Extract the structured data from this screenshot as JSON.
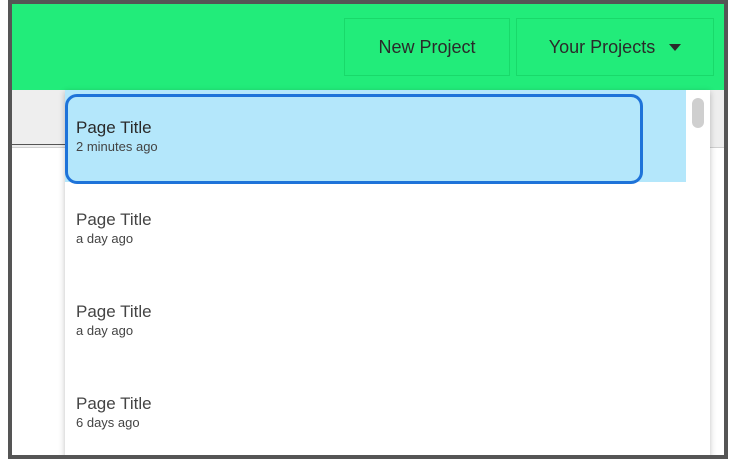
{
  "topbar": {
    "new_project_label": "New Project",
    "your_projects_label": "Your Projects"
  },
  "projects": [
    {
      "title": "Page Title",
      "time": "2 minutes ago",
      "selected": true
    },
    {
      "title": "Page Title",
      "time": "a day ago"
    },
    {
      "title": "Page Title",
      "time": "a day ago"
    },
    {
      "title": "Page Title",
      "time": "6 days ago"
    }
  ],
  "colors": {
    "topbar": "#22ec7a",
    "selected_item": "#b4e7fb",
    "highlight_ring": "#1e73d9"
  }
}
